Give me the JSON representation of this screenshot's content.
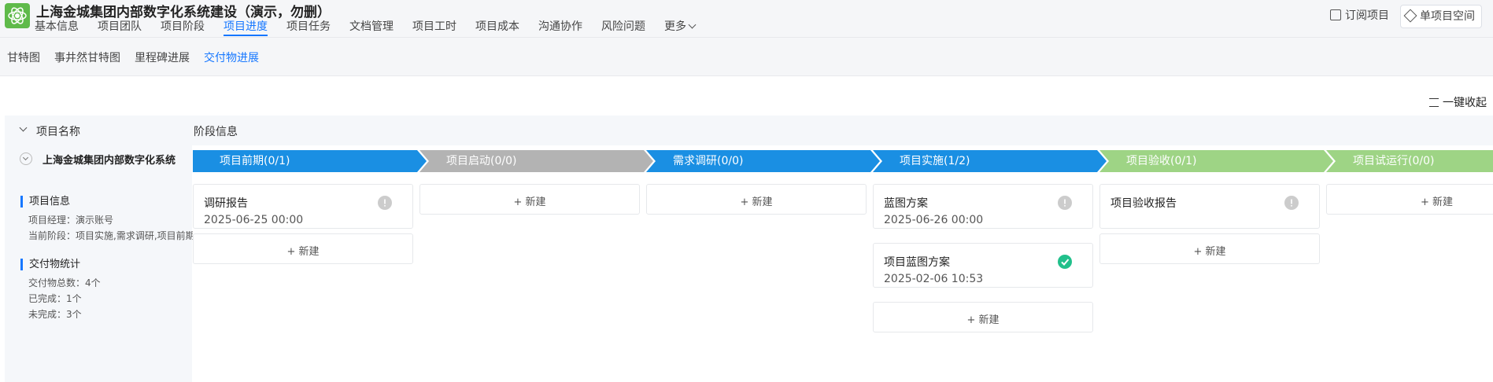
{
  "header": {
    "project_title": "上海金城集团内部数字化系统建设（演示，勿删）",
    "nav": [
      "基本信息",
      "项目团队",
      "项目阶段",
      "项目进度",
      "项目任务",
      "文档管理",
      "项目工时",
      "项目成本",
      "沟通协作",
      "风险问题",
      "更多"
    ],
    "active_nav": "项目进度",
    "subscribe_label": "订阅项目",
    "workspace_label": "单项目空间"
  },
  "subnav": {
    "items": [
      "甘特图",
      "事井然甘特图",
      "里程碑进展",
      "交付物进展"
    ],
    "active": "交付物进展"
  },
  "toolbar": {
    "collapse_all": "一键收起"
  },
  "table": {
    "name_header": "项目名称",
    "stage_header": "阶段信息"
  },
  "project": {
    "name": "上海金城集团内部数字化系统",
    "info_title": "项目信息",
    "manager_line": "项目经理：演示账号",
    "current_stage_line": "当前阶段：项目实施,需求调研,项目前期",
    "stats_title": "交付物统计",
    "total_line": "交付物总数：4个",
    "done_line": "已完成：1个",
    "undone_line": "未完成：3个"
  },
  "colors": {
    "accent": "#1677ff",
    "stage_blue": "#1a8fe3",
    "stage_gray": "#b3b3b3",
    "stage_green": "#9ed485",
    "done_green": "#21c08b",
    "pending_gray": "#cccccc"
  },
  "stages": [
    {
      "label": "项目前期(0/1)",
      "color": "blue",
      "cards": [
        {
          "title": "调研报告",
          "date": "2025-06-25 00:00",
          "status": "pending"
        }
      ],
      "new_label": "+ 新建"
    },
    {
      "label": "项目启动(0/0)",
      "color": "gray",
      "cards": [],
      "new_label": "+ 新建"
    },
    {
      "label": "需求调研(0/0)",
      "color": "blue",
      "cards": [],
      "new_label": "+ 新建"
    },
    {
      "label": "项目实施(1/2)",
      "color": "blue",
      "cards": [
        {
          "title": "蓝图方案",
          "date": "2025-06-26 00:00",
          "status": "pending"
        },
        {
          "title": "项目蓝图方案",
          "date": "2025-02-06 10:53",
          "status": "done"
        }
      ],
      "new_label": "+ 新建"
    },
    {
      "label": "项目验收(0/1)",
      "color": "green",
      "cards": [
        {
          "title": "项目验收报告",
          "date": "",
          "status": "pending"
        }
      ],
      "new_label": "+ 新建"
    },
    {
      "label": "项目试运行(0/0)",
      "color": "green",
      "cards": [],
      "new_label": "+ 新建"
    }
  ]
}
